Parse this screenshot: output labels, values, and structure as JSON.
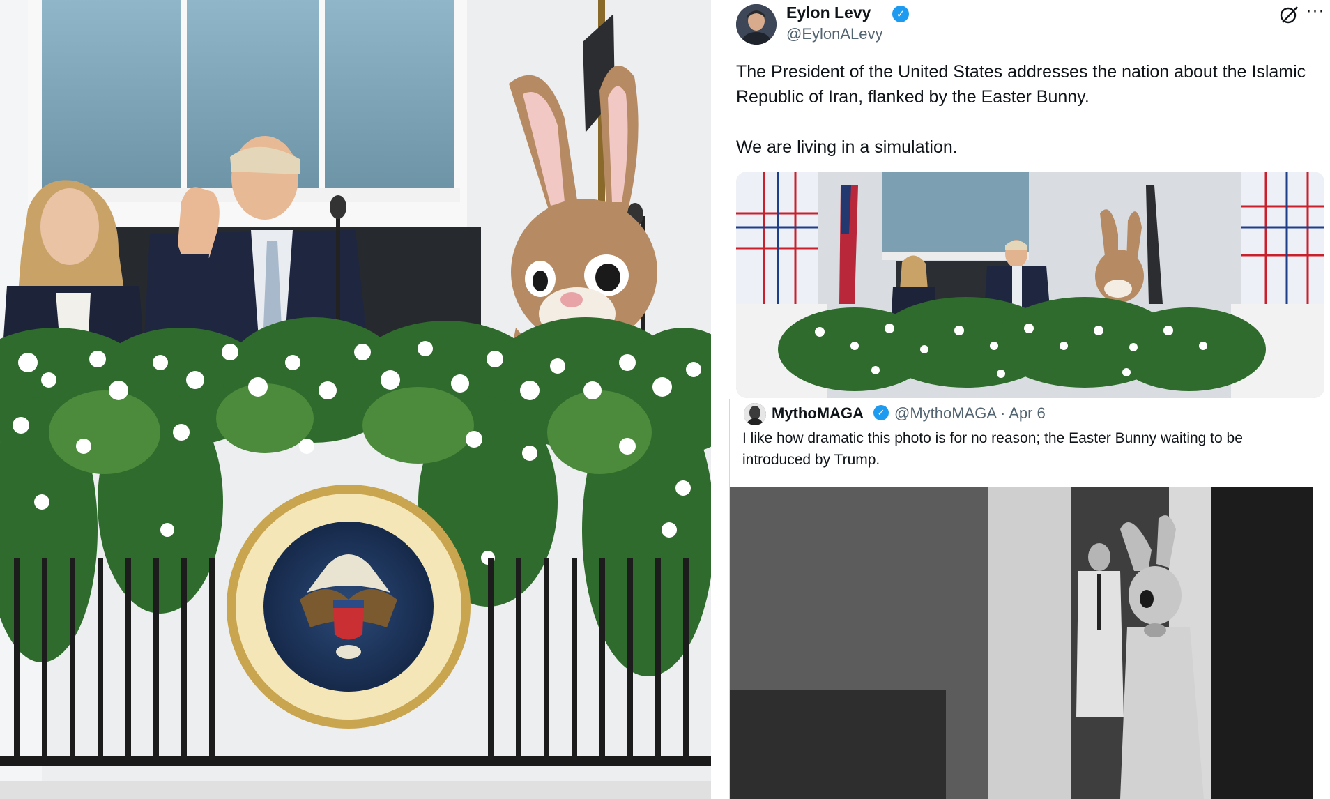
{
  "tweet": {
    "author_name": "Eylon Levy",
    "author_handle": "@EylonALevy",
    "text_line1": "The President of the United States addresses the nation about the Islamic Republic of Iran, flanked by the Easter Bunny.",
    "text_line2": "We are living in a simulation.",
    "verified_color": "#1d9bf0"
  },
  "quote": {
    "author_name": "MythoMAGA",
    "author_handle": "@MythoMAGA",
    "separator": "·",
    "date": "Apr 6",
    "text": "I like how dramatic this photo is for no reason; the Easter Bunny waiting to be introduced by Trump."
  },
  "seal": {
    "text": "SEAL OF THE PRESIDENT OF THE UNITED STATES"
  },
  "icons": {
    "verified": "verified-badge-icon",
    "grok": "grok-slash-icon",
    "more": "more-options-icon"
  }
}
